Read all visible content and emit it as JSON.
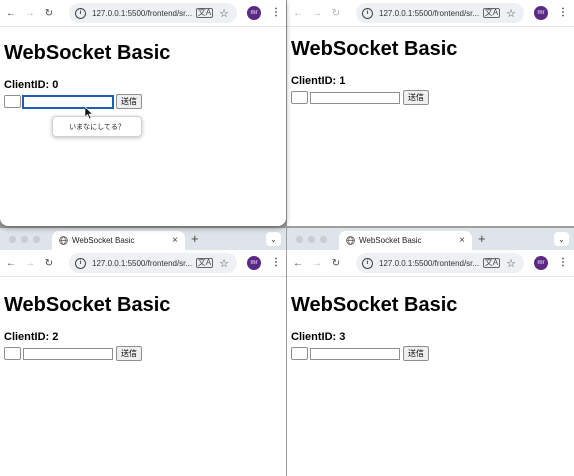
{
  "url": "127.0.0.1:5500/frontend/sr...",
  "tab_title": "WebSocket Basic",
  "avatar_initials": "mr",
  "page_heading": "WebSocket Basic",
  "send_label": "送信",
  "clients": [
    {
      "client_id": "ClientID: 0",
      "message_placeholder": "いまなにしてる？"
    },
    {
      "client_id": "ClientID: 1"
    },
    {
      "client_id": "ClientID: 2"
    },
    {
      "client_id": "ClientID: 3"
    }
  ],
  "icons": {
    "back": "arrow-left-icon",
    "forward": "arrow-right-icon",
    "reload": "reload-icon",
    "site_info": "info-icon",
    "translate": "translate-icon",
    "bookmark": "star-icon",
    "menu": "kebab-menu-icon"
  },
  "colors": {
    "focus_border": "#1a5fb4",
    "avatar_bg": "#5b2a86",
    "tabstrip_bg": "#dfe3ea",
    "omnibox_bg": "#eef0f4"
  }
}
